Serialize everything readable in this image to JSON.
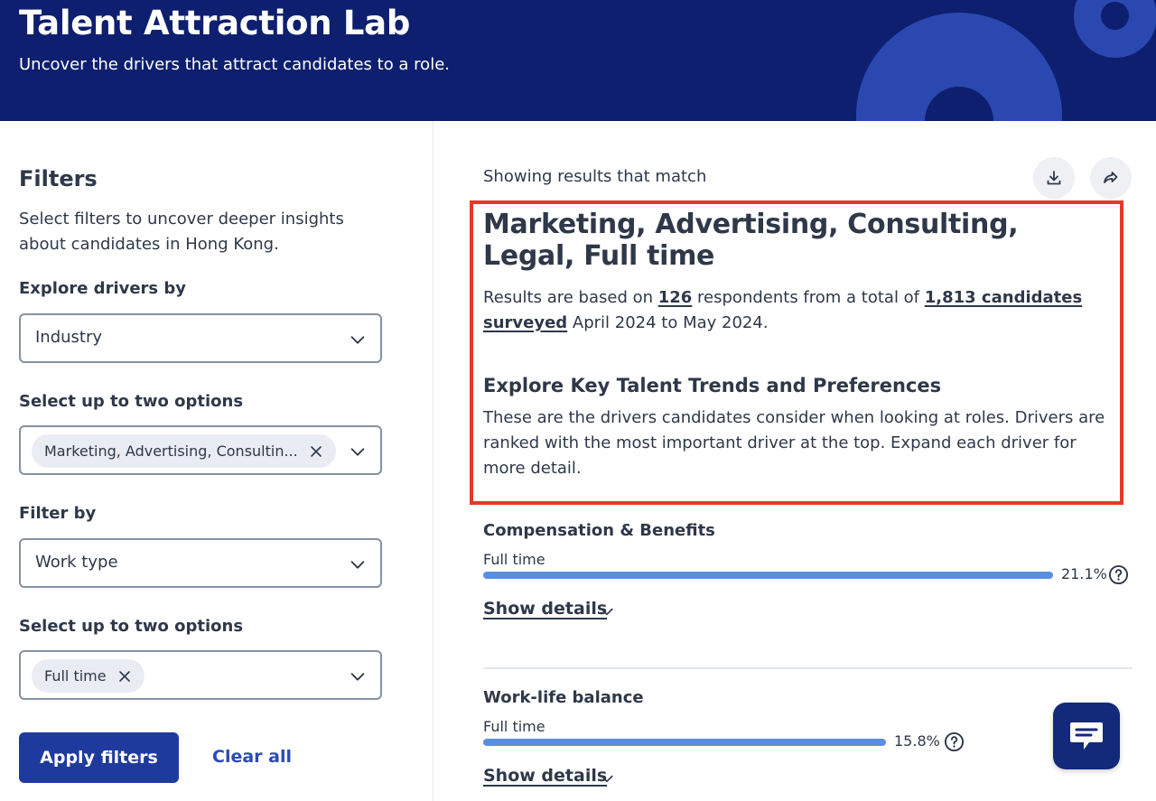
{
  "header": {
    "title": "Talent Attraction Lab",
    "subtitle": "Uncover the drivers that attract candidates to a role."
  },
  "filters": {
    "title": "Filters",
    "description": "Select filters to uncover deeper insights about candidates in Hong Kong.",
    "explore_label": "Explore drivers by",
    "explore_value": "Industry",
    "options1_label": "Select up to two options",
    "options1_chip": "Marketing, Advertising, Consultin...",
    "filter_by_label": "Filter by",
    "filter_by_value": "Work type",
    "options2_label": "Select up to two options",
    "options2_chip": "Full time",
    "apply_label": "Apply filters",
    "clear_label": "Clear all"
  },
  "results": {
    "showing": "Showing results that match",
    "title": "Marketing, Advertising, Consulting, Legal, Full time",
    "text_prefix": "Results are based on ",
    "respondents": "126",
    "text_mid": " respondents from a total of ",
    "total": "1,813 candidates surveyed",
    "text_suffix": " April 2024 to May 2024.",
    "explore_title": "Explore Key Talent Trends and Preferences",
    "explore_text": "These are the drivers candidates consider when looking at roles. Drivers are ranked with the most important driver at the top. Expand each driver for more detail."
  },
  "drivers": [
    {
      "name": "Compensation & Benefits",
      "sub": "Full time",
      "percent": 21.1,
      "percent_label": "21.1%",
      "details_label": "Show details"
    },
    {
      "name": "Work-life balance",
      "sub": "Full time",
      "percent": 15.8,
      "percent_label": "15.8%",
      "details_label": "Show details"
    }
  ],
  "icons": {
    "download": "download-icon",
    "share": "share-icon",
    "help": "help-circle-icon",
    "chat": "chat-icon"
  },
  "colors": {
    "banner": "#0d1f6e",
    "accent": "#1e3a9c",
    "bar": "#5a8fe0",
    "highlight": "#e53a24"
  }
}
